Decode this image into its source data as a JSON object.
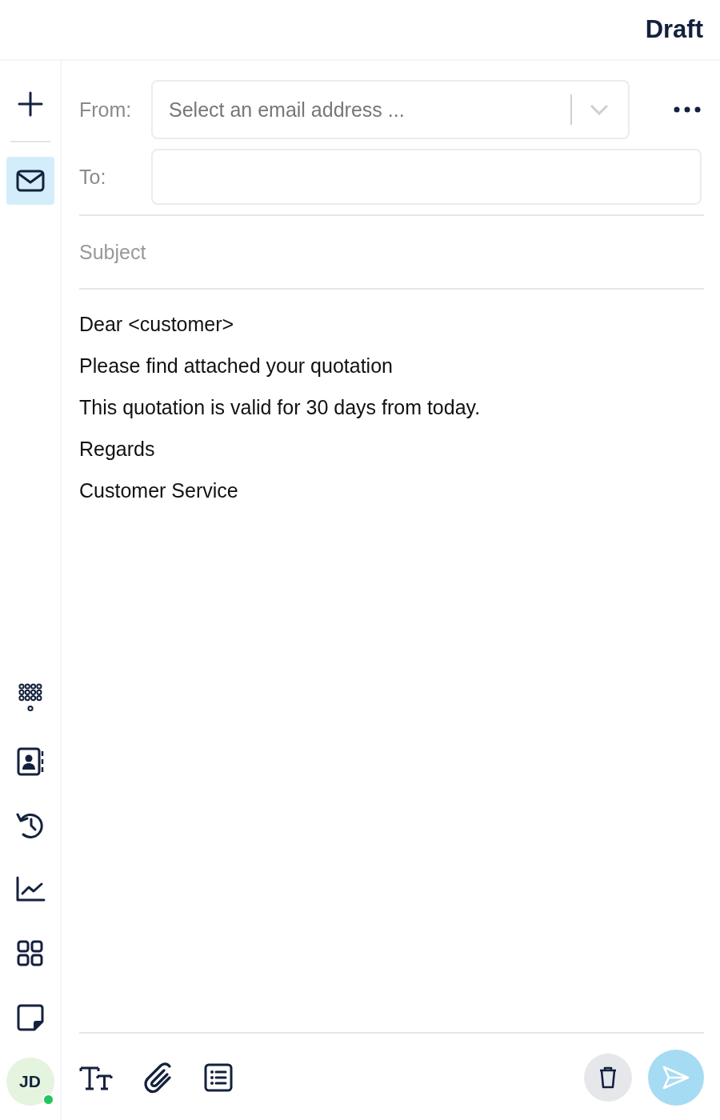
{
  "header": {
    "title": "Draft"
  },
  "sidebar": {
    "top": [
      {
        "kind": "compose",
        "selected": false
      },
      {
        "kind": "mail",
        "selected": true
      }
    ],
    "bottom": [
      {
        "kind": "dialpad",
        "selected": false
      },
      {
        "kind": "contacts",
        "selected": false
      },
      {
        "kind": "history",
        "selected": false
      },
      {
        "kind": "analytics",
        "selected": false
      },
      {
        "kind": "apps",
        "selected": false
      },
      {
        "kind": "notes",
        "selected": false
      }
    ],
    "avatar": {
      "initials": "JD",
      "online": true
    }
  },
  "form": {
    "from_label": "From:",
    "from_placeholder": "Select an email address ...",
    "to_label": "To:",
    "subject_placeholder": "Subject"
  },
  "body": [
    "Dear <customer>",
    "Please find attached your quotation",
    "This quotation is valid for 30 days from today.",
    "Regards",
    "Customer Service"
  ],
  "toolbar": {
    "tools": [
      {
        "kind": "text-format"
      },
      {
        "kind": "attach"
      },
      {
        "kind": "list"
      }
    ],
    "send_disabled": true
  }
}
